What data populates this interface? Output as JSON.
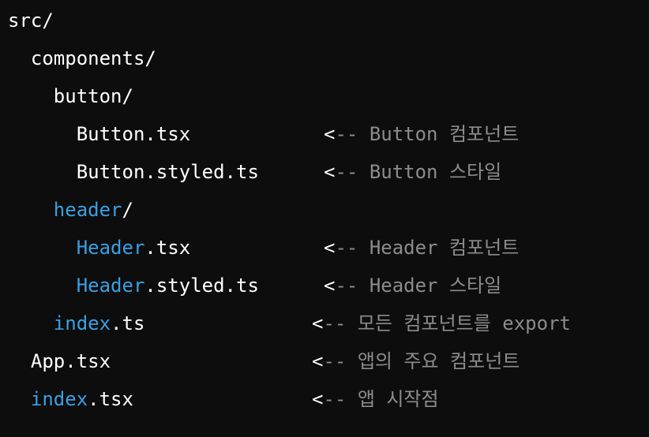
{
  "tree": {
    "lines": [
      {
        "indent": "",
        "segments": [
          {
            "text": "src/",
            "color": "white"
          }
        ]
      },
      {
        "indent": "  ",
        "segments": [
          {
            "text": "components/",
            "color": "white"
          }
        ]
      },
      {
        "indent": "    ",
        "segments": [
          {
            "text": "button/",
            "color": "white"
          }
        ]
      },
      {
        "indent": "      ",
        "segments": [
          {
            "text": "Button.tsx",
            "color": "white"
          }
        ],
        "arrow_col": 400,
        "comment": "Button 컴포넌트"
      },
      {
        "indent": "      ",
        "segments": [
          {
            "text": "Button.styled.ts",
            "color": "white"
          }
        ],
        "arrow_col": 400,
        "comment": "Button 스타일"
      },
      {
        "indent": "    ",
        "segments": [
          {
            "text": "header",
            "color": "blue"
          },
          {
            "text": "/",
            "color": "white"
          }
        ]
      },
      {
        "indent": "      ",
        "segments": [
          {
            "text": "Header",
            "color": "blue"
          },
          {
            "text": ".tsx",
            "color": "white"
          }
        ],
        "arrow_col": 400,
        "comment": "Header 컴포넌트"
      },
      {
        "indent": "      ",
        "segments": [
          {
            "text": "Header",
            "color": "blue"
          },
          {
            "text": ".styled.ts",
            "color": "white"
          }
        ],
        "arrow_col": 400,
        "comment": "Header 스타일"
      },
      {
        "indent": "    ",
        "segments": [
          {
            "text": "index",
            "color": "blue"
          },
          {
            "text": ".ts",
            "color": "white"
          }
        ],
        "arrow_col": 385,
        "comment": "모든 컴포넌트를 export"
      },
      {
        "indent": "  ",
        "segments": [
          {
            "text": "App.tsx",
            "color": "white"
          }
        ],
        "arrow_col": 385,
        "comment": "앱의 주요 컴포넌트"
      },
      {
        "indent": "  ",
        "segments": [
          {
            "text": "index",
            "color": "blue"
          },
          {
            "text": ".tsx",
            "color": "white"
          }
        ],
        "arrow_col": 385,
        "comment": "앱 시작점"
      }
    ],
    "arrow_lt": "<",
    "arrow_dashes": "--"
  },
  "colors": {
    "background": "#0d0d0d",
    "white": "#ffffff",
    "blue": "#3aa0e4",
    "gray": "#8c8c8c"
  }
}
